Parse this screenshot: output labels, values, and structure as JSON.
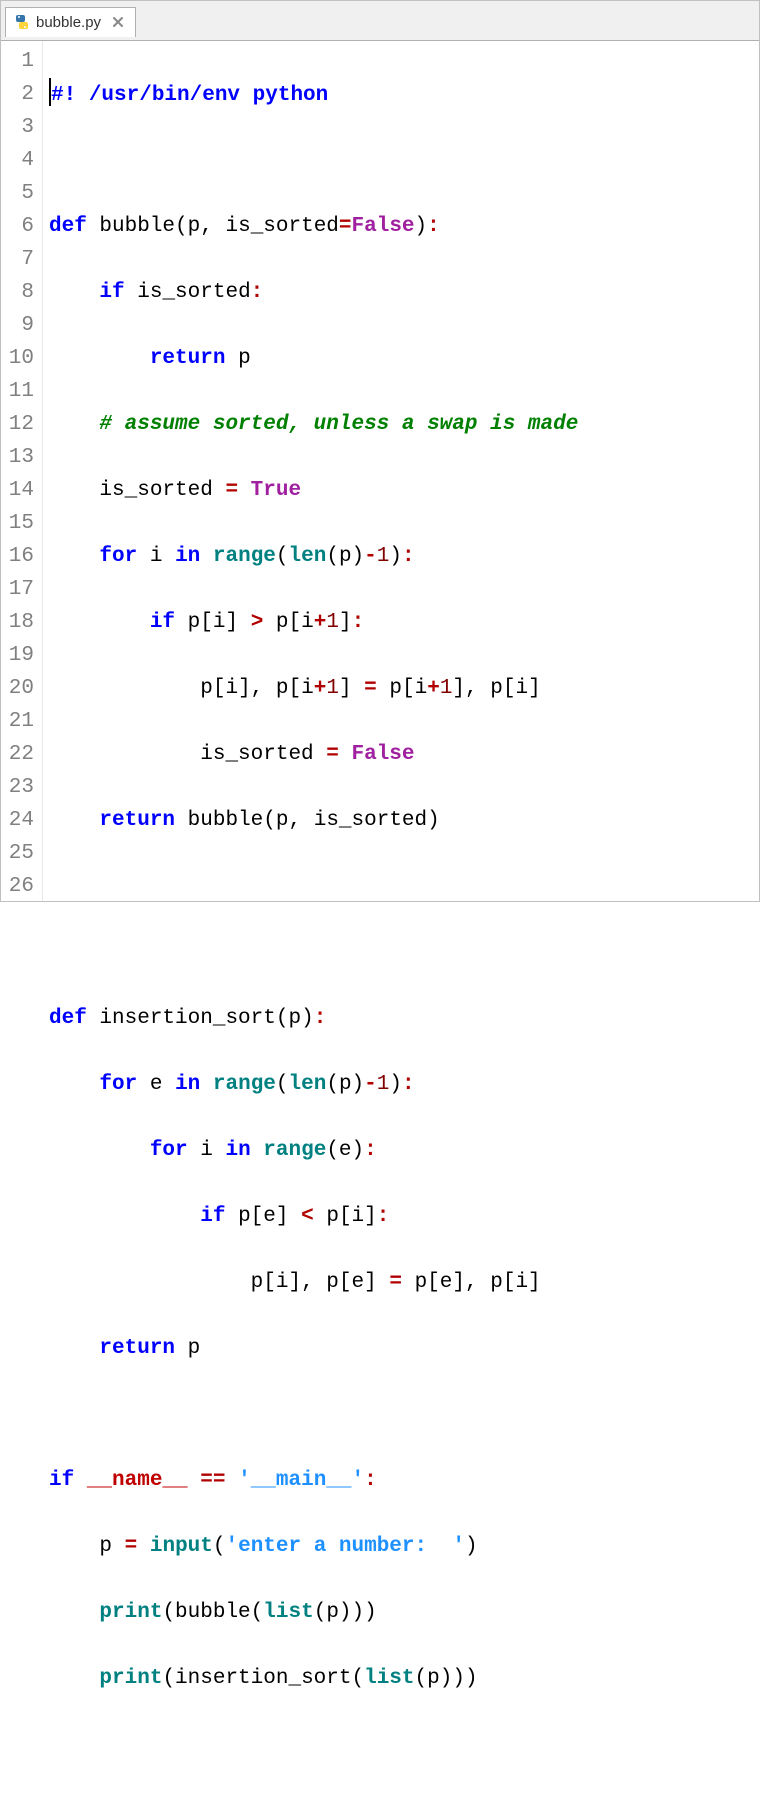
{
  "tab": {
    "filename": "bubble.py"
  },
  "gutter": [
    "1",
    "2",
    "3",
    "4",
    "5",
    "6",
    "7",
    "8",
    "9",
    "10",
    "11",
    "12",
    "13",
    "14",
    "15",
    "16",
    "17",
    "18",
    "19",
    "20",
    "21",
    "22",
    "23",
    "24",
    "25",
    "26"
  ],
  "code": {
    "l1": {
      "shebang1": "#",
      "shebang2": "! /usr/bin/env python"
    },
    "l3": {
      "kw": "def",
      "fn": "bubble",
      "p1": "p",
      "p2": "is_sorted",
      "eq": "=",
      "false": "False",
      "colon": ":"
    },
    "l4": {
      "kw": "if",
      "var": "is_sorted",
      "colon": ":"
    },
    "l5": {
      "kw": "return",
      "var": "p"
    },
    "l6": {
      "comment": "# assume sorted, unless a swap is made"
    },
    "l7": {
      "var": "is_sorted",
      "eq": "=",
      "true": "True"
    },
    "l8": {
      "for": "for",
      "i": "i",
      "in": "in",
      "range": "range",
      "len": "len",
      "p": "p",
      "minus": "-",
      "one": "1",
      "colon": ":"
    },
    "l9": {
      "if": "if",
      "p1": "p",
      "i1": "i",
      "gt": ">",
      "p2": "p",
      "i2": "i",
      "plus": "+",
      "one": "1",
      "colon": ":"
    },
    "l10": {
      "p1": "p",
      "i1": "i",
      "c1": ",",
      "p2": "p",
      "i2": "i",
      "plus1": "+",
      "one1": "1",
      "eq": "=",
      "p3": "p",
      "i3": "i",
      "plus2": "+",
      "one2": "1",
      "c2": ",",
      "p4": "p",
      "i4": "i"
    },
    "l11": {
      "var": "is_sorted",
      "eq": "=",
      "false": "False"
    },
    "l12": {
      "kw": "return",
      "fn": "bubble",
      "p": "p",
      "c": ",",
      "var": "is_sorted"
    },
    "l15": {
      "kw": "def",
      "fn": "insertion_sort",
      "p": "p",
      "colon": ":"
    },
    "l16": {
      "for": "for",
      "e": "e",
      "in": "in",
      "range": "range",
      "len": "len",
      "p": "p",
      "minus": "-",
      "one": "1",
      "colon": ":"
    },
    "l17": {
      "for": "for",
      "i": "i",
      "in": "in",
      "range": "range",
      "e": "e",
      "colon": ":"
    },
    "l18": {
      "if": "if",
      "p1": "p",
      "e": "e",
      "lt": "<",
      "p2": "p",
      "i": "i",
      "colon": ":"
    },
    "l19": {
      "p1": "p",
      "i1": "i",
      "c1": ",",
      "p2": "p",
      "e1": "e",
      "eq": "=",
      "p3": "p",
      "e2": "e",
      "c2": ",",
      "p4": "p",
      "i2": "i"
    },
    "l20": {
      "kw": "return",
      "p": "p"
    },
    "l22": {
      "if": "if",
      "name": "__name__",
      "eq": "==",
      "str": "'__main__'",
      "colon": ":"
    },
    "l23": {
      "p": "p",
      "eq": "=",
      "input": "input",
      "str": "'enter a number:  '"
    },
    "l24": {
      "print": "print",
      "bubble": "bubble",
      "list": "list",
      "p": "p"
    },
    "l25": {
      "print": "print",
      "ins": "insertion_sort",
      "list": "list",
      "p": "p"
    }
  }
}
